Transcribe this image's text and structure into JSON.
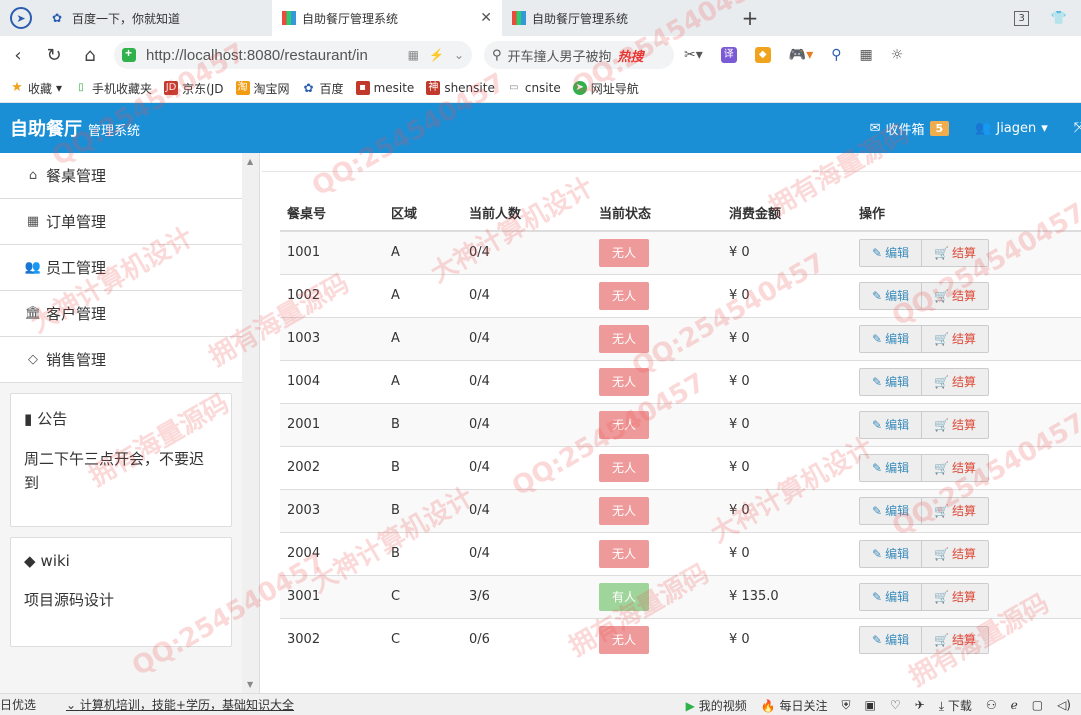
{
  "browser": {
    "tabs": [
      {
        "title": "百度一下，你就知道",
        "active": false
      },
      {
        "title": "自助餐厅管理系统",
        "active": true
      },
      {
        "title": "自助餐厅管理系统",
        "active": false
      }
    ],
    "tab_count": "3",
    "url": "http://localhost:8080/restaurant/in",
    "search_text": "开车撞人男子被拘",
    "search_hot": "热搜",
    "translate_label": "译",
    "bookmarks": [
      "收藏",
      "手机收藏夹",
      "京东(JD",
      "淘宝网",
      "百度",
      "mesite",
      "shensite",
      "cnsite",
      "网址导航"
    ]
  },
  "app": {
    "brand": "自助餐厅",
    "brand_sub": "管理系统",
    "inbox_label": "收件箱",
    "inbox_count": "5",
    "user_name": "Jiagen"
  },
  "sidebar": {
    "menu": [
      {
        "label": "餐桌管理",
        "icon": "home-icon"
      },
      {
        "label": "订单管理",
        "icon": "table-icon"
      },
      {
        "label": "员工管理",
        "icon": "users-icon"
      },
      {
        "label": "客户管理",
        "icon": "bank-icon"
      },
      {
        "label": "销售管理",
        "icon": "diamond-icon"
      }
    ],
    "notice": {
      "title": "公告",
      "body": "周二下午三点开会，不要迟到"
    },
    "wiki": {
      "title": "wiki",
      "body": "项目源码设计"
    }
  },
  "table": {
    "headers": [
      "餐桌号",
      "区域",
      "当前人数",
      "当前状态",
      "消费金额",
      "操作"
    ],
    "edit_label": "编辑",
    "pay_label": "结算",
    "currency": "¥",
    "rows": [
      {
        "id": "1001",
        "area": "A",
        "people": "0/4",
        "status": "无人",
        "busy": false,
        "amount": "0"
      },
      {
        "id": "1002",
        "area": "A",
        "people": "0/4",
        "status": "无人",
        "busy": false,
        "amount": "0"
      },
      {
        "id": "1003",
        "area": "A",
        "people": "0/4",
        "status": "无人",
        "busy": false,
        "amount": "0"
      },
      {
        "id": "1004",
        "area": "A",
        "people": "0/4",
        "status": "无人",
        "busy": false,
        "amount": "0"
      },
      {
        "id": "2001",
        "area": "B",
        "people": "0/4",
        "status": "无人",
        "busy": false,
        "amount": "0"
      },
      {
        "id": "2002",
        "area": "B",
        "people": "0/4",
        "status": "无人",
        "busy": false,
        "amount": "0"
      },
      {
        "id": "2003",
        "area": "B",
        "people": "0/4",
        "status": "无人",
        "busy": false,
        "amount": "0"
      },
      {
        "id": "2004",
        "area": "B",
        "people": "0/4",
        "status": "无人",
        "busy": false,
        "amount": "0"
      },
      {
        "id": "3001",
        "area": "C",
        "people": "3/6",
        "status": "有人",
        "busy": true,
        "amount": "135.0"
      },
      {
        "id": "3002",
        "area": "C",
        "people": "0/6",
        "status": "无人",
        "busy": false,
        "amount": "0"
      }
    ]
  },
  "statusbar": {
    "left": [
      "日优选",
      "计算机培训，技能+学历，基础知识大全"
    ],
    "right": [
      "我的视频",
      "每日关注",
      "下载"
    ]
  },
  "watermarks": [
    "QQ:254540457",
    "大神计算机设计",
    "拥有海量源码"
  ],
  "colors": {
    "header": "#1a8fd6",
    "badge": "#f0ad4e",
    "status_empty": "#ef9a9a",
    "status_busy": "#9fd49a"
  }
}
